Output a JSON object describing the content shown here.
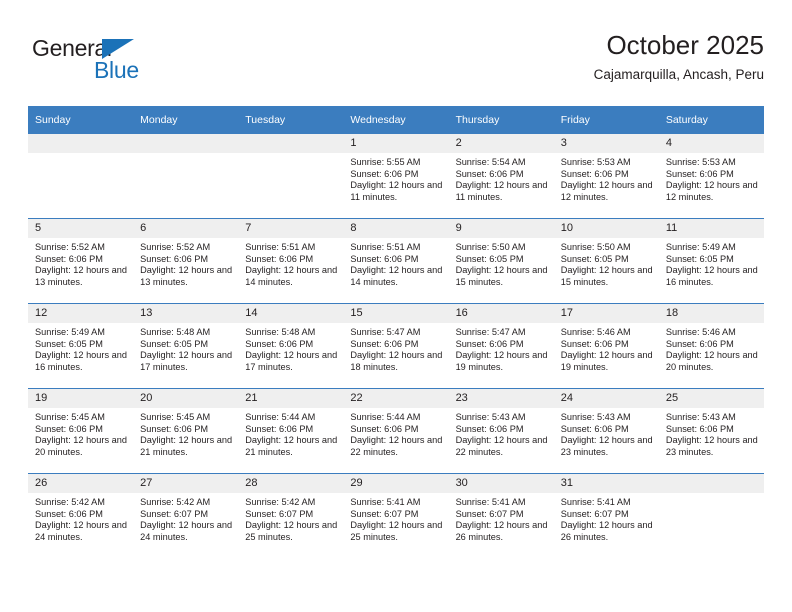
{
  "brand": {
    "name_top": "General",
    "name_bottom": "Blue",
    "triangle_icon": "triangle-icon",
    "accent_color": "#1b72b8"
  },
  "header": {
    "title": "October 2025",
    "subtitle": "Cajamarquilla, Ancash, Peru"
  },
  "theme": {
    "header_row_bg": "#3b7dbf",
    "daynum_bg": "#efefef",
    "text_color": "#231f20"
  },
  "weekday_headers": [
    "Sunday",
    "Monday",
    "Tuesday",
    "Wednesday",
    "Thursday",
    "Friday",
    "Saturday"
  ],
  "labels": {
    "sunrise": "Sunrise:",
    "sunset": "Sunset:",
    "daylight": "Daylight:"
  },
  "weeks": [
    [
      {
        "day": "",
        "empty": true
      },
      {
        "day": "",
        "empty": true
      },
      {
        "day": "",
        "empty": true
      },
      {
        "day": "1",
        "sunrise": "Sunrise: 5:55 AM",
        "sunset": "Sunset: 6:06 PM",
        "daylight": "Daylight: 12 hours and 11 minutes."
      },
      {
        "day": "2",
        "sunrise": "Sunrise: 5:54 AM",
        "sunset": "Sunset: 6:06 PM",
        "daylight": "Daylight: 12 hours and 11 minutes."
      },
      {
        "day": "3",
        "sunrise": "Sunrise: 5:53 AM",
        "sunset": "Sunset: 6:06 PM",
        "daylight": "Daylight: 12 hours and 12 minutes."
      },
      {
        "day": "4",
        "sunrise": "Sunrise: 5:53 AM",
        "sunset": "Sunset: 6:06 PM",
        "daylight": "Daylight: 12 hours and 12 minutes."
      }
    ],
    [
      {
        "day": "5",
        "sunrise": "Sunrise: 5:52 AM",
        "sunset": "Sunset: 6:06 PM",
        "daylight": "Daylight: 12 hours and 13 minutes."
      },
      {
        "day": "6",
        "sunrise": "Sunrise: 5:52 AM",
        "sunset": "Sunset: 6:06 PM",
        "daylight": "Daylight: 12 hours and 13 minutes."
      },
      {
        "day": "7",
        "sunrise": "Sunrise: 5:51 AM",
        "sunset": "Sunset: 6:06 PM",
        "daylight": "Daylight: 12 hours and 14 minutes."
      },
      {
        "day": "8",
        "sunrise": "Sunrise: 5:51 AM",
        "sunset": "Sunset: 6:06 PM",
        "daylight": "Daylight: 12 hours and 14 minutes."
      },
      {
        "day": "9",
        "sunrise": "Sunrise: 5:50 AM",
        "sunset": "Sunset: 6:05 PM",
        "daylight": "Daylight: 12 hours and 15 minutes."
      },
      {
        "day": "10",
        "sunrise": "Sunrise: 5:50 AM",
        "sunset": "Sunset: 6:05 PM",
        "daylight": "Daylight: 12 hours and 15 minutes."
      },
      {
        "day": "11",
        "sunrise": "Sunrise: 5:49 AM",
        "sunset": "Sunset: 6:05 PM",
        "daylight": "Daylight: 12 hours and 16 minutes."
      }
    ],
    [
      {
        "day": "12",
        "sunrise": "Sunrise: 5:49 AM",
        "sunset": "Sunset: 6:05 PM",
        "daylight": "Daylight: 12 hours and 16 minutes."
      },
      {
        "day": "13",
        "sunrise": "Sunrise: 5:48 AM",
        "sunset": "Sunset: 6:05 PM",
        "daylight": "Daylight: 12 hours and 17 minutes."
      },
      {
        "day": "14",
        "sunrise": "Sunrise: 5:48 AM",
        "sunset": "Sunset: 6:06 PM",
        "daylight": "Daylight: 12 hours and 17 minutes."
      },
      {
        "day": "15",
        "sunrise": "Sunrise: 5:47 AM",
        "sunset": "Sunset: 6:06 PM",
        "daylight": "Daylight: 12 hours and 18 minutes."
      },
      {
        "day": "16",
        "sunrise": "Sunrise: 5:47 AM",
        "sunset": "Sunset: 6:06 PM",
        "daylight": "Daylight: 12 hours and 19 minutes."
      },
      {
        "day": "17",
        "sunrise": "Sunrise: 5:46 AM",
        "sunset": "Sunset: 6:06 PM",
        "daylight": "Daylight: 12 hours and 19 minutes."
      },
      {
        "day": "18",
        "sunrise": "Sunrise: 5:46 AM",
        "sunset": "Sunset: 6:06 PM",
        "daylight": "Daylight: 12 hours and 20 minutes."
      }
    ],
    [
      {
        "day": "19",
        "sunrise": "Sunrise: 5:45 AM",
        "sunset": "Sunset: 6:06 PM",
        "daylight": "Daylight: 12 hours and 20 minutes."
      },
      {
        "day": "20",
        "sunrise": "Sunrise: 5:45 AM",
        "sunset": "Sunset: 6:06 PM",
        "daylight": "Daylight: 12 hours and 21 minutes."
      },
      {
        "day": "21",
        "sunrise": "Sunrise: 5:44 AM",
        "sunset": "Sunset: 6:06 PM",
        "daylight": "Daylight: 12 hours and 21 minutes."
      },
      {
        "day": "22",
        "sunrise": "Sunrise: 5:44 AM",
        "sunset": "Sunset: 6:06 PM",
        "daylight": "Daylight: 12 hours and 22 minutes."
      },
      {
        "day": "23",
        "sunrise": "Sunrise: 5:43 AM",
        "sunset": "Sunset: 6:06 PM",
        "daylight": "Daylight: 12 hours and 22 minutes."
      },
      {
        "day": "24",
        "sunrise": "Sunrise: 5:43 AM",
        "sunset": "Sunset: 6:06 PM",
        "daylight": "Daylight: 12 hours and 23 minutes."
      },
      {
        "day": "25",
        "sunrise": "Sunrise: 5:43 AM",
        "sunset": "Sunset: 6:06 PM",
        "daylight": "Daylight: 12 hours and 23 minutes."
      }
    ],
    [
      {
        "day": "26",
        "sunrise": "Sunrise: 5:42 AM",
        "sunset": "Sunset: 6:06 PM",
        "daylight": "Daylight: 12 hours and 24 minutes."
      },
      {
        "day": "27",
        "sunrise": "Sunrise: 5:42 AM",
        "sunset": "Sunset: 6:07 PM",
        "daylight": "Daylight: 12 hours and 24 minutes."
      },
      {
        "day": "28",
        "sunrise": "Sunrise: 5:42 AM",
        "sunset": "Sunset: 6:07 PM",
        "daylight": "Daylight: 12 hours and 25 minutes."
      },
      {
        "day": "29",
        "sunrise": "Sunrise: 5:41 AM",
        "sunset": "Sunset: 6:07 PM",
        "daylight": "Daylight: 12 hours and 25 minutes."
      },
      {
        "day": "30",
        "sunrise": "Sunrise: 5:41 AM",
        "sunset": "Sunset: 6:07 PM",
        "daylight": "Daylight: 12 hours and 26 minutes."
      },
      {
        "day": "31",
        "sunrise": "Sunrise: 5:41 AM",
        "sunset": "Sunset: 6:07 PM",
        "daylight": "Daylight: 12 hours and 26 minutes."
      },
      {
        "day": "",
        "empty": true
      }
    ]
  ]
}
